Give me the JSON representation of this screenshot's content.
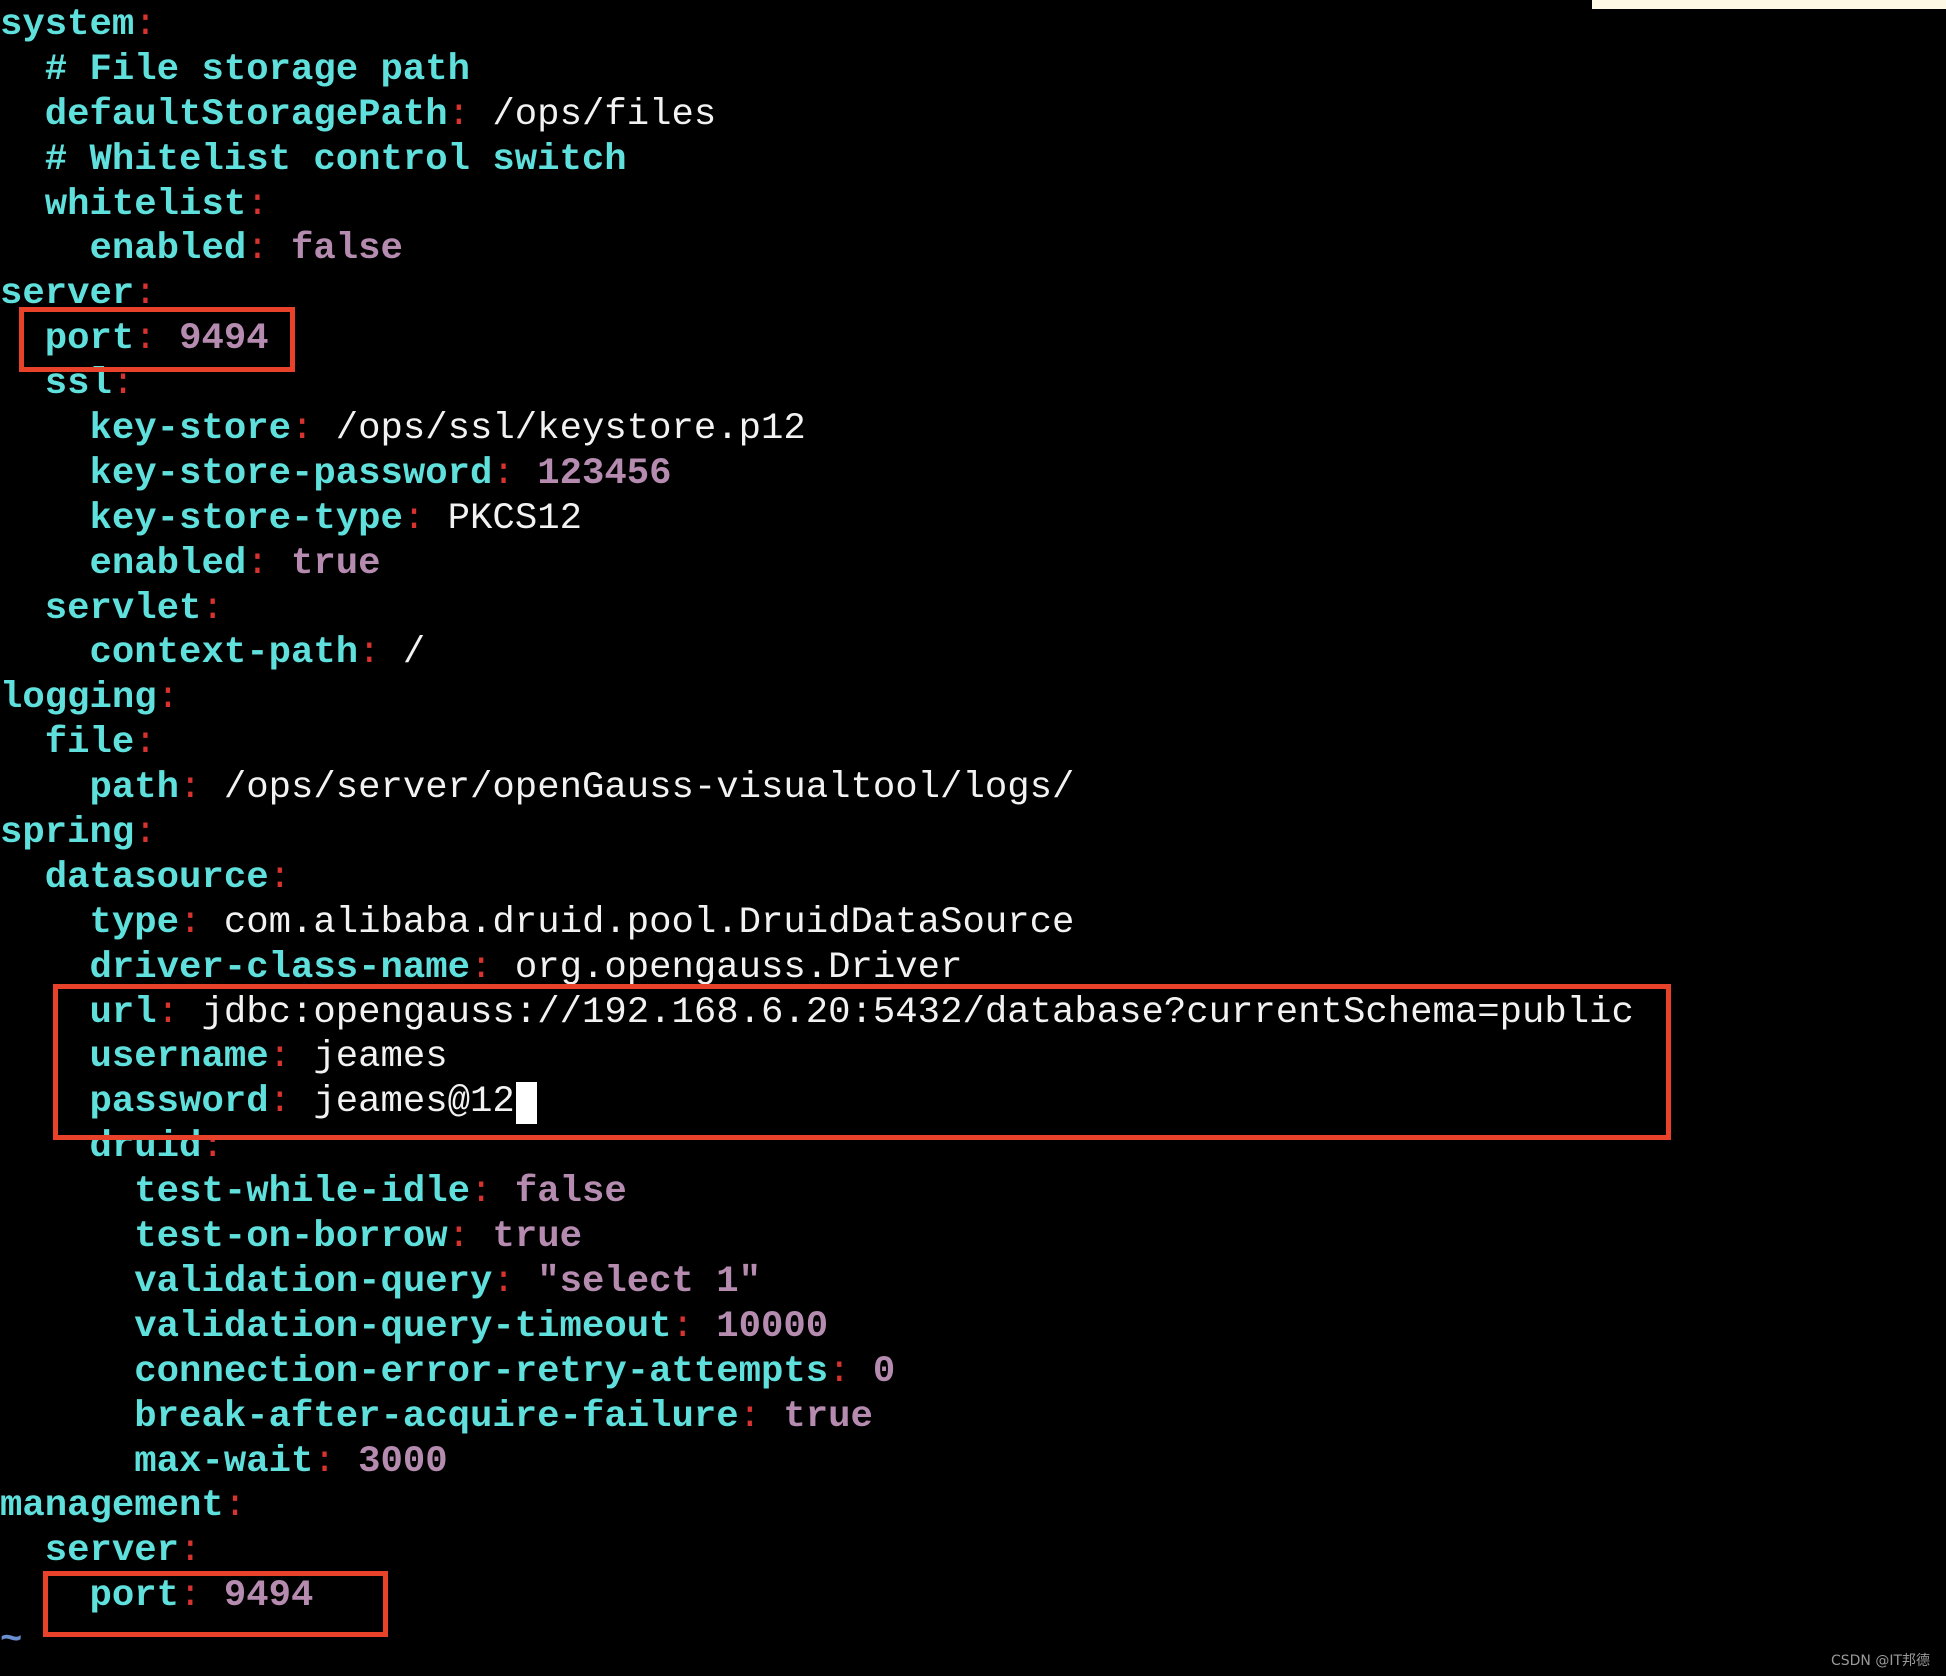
{
  "colors": {
    "key": "#5fe0dc",
    "colon": "#d8332e",
    "string": "#f2f2f2",
    "literal": "#b58bb0",
    "highlight_box": "#e8432a",
    "tilde": "#6a8fd0"
  },
  "lines": [
    {
      "indent": 0,
      "key": "system"
    },
    {
      "indent": 2,
      "comment": "# File storage path"
    },
    {
      "indent": 2,
      "key": "defaultStoragePath",
      "value": "/ops/files",
      "type": "string"
    },
    {
      "indent": 2,
      "comment": "# Whitelist control switch"
    },
    {
      "indent": 2,
      "key": "whitelist"
    },
    {
      "indent": 4,
      "key": "enabled",
      "value": "false",
      "type": "literal"
    },
    {
      "indent": 0,
      "key": "server"
    },
    {
      "indent": 2,
      "key": "port",
      "value": "9494",
      "type": "literal"
    },
    {
      "indent": 2,
      "key": "ssl"
    },
    {
      "indent": 4,
      "key": "key-store",
      "value": "/ops/ssl/keystore.p12",
      "type": "string"
    },
    {
      "indent": 4,
      "key": "key-store-password",
      "value": "123456",
      "type": "literal"
    },
    {
      "indent": 4,
      "key": "key-store-type",
      "value": "PKCS12",
      "type": "string"
    },
    {
      "indent": 4,
      "key": "enabled",
      "value": "true",
      "type": "literal"
    },
    {
      "indent": 2,
      "key": "servlet"
    },
    {
      "indent": 4,
      "key": "context-path",
      "value": "/",
      "type": "string"
    },
    {
      "indent": 0,
      "key": "logging"
    },
    {
      "indent": 2,
      "key": "file"
    },
    {
      "indent": 4,
      "key": "path",
      "value": "/ops/server/openGauss-visualtool/logs/",
      "type": "string"
    },
    {
      "indent": 0,
      "key": "spring"
    },
    {
      "indent": 2,
      "key": "datasource"
    },
    {
      "indent": 4,
      "key": "type",
      "value": "com.alibaba.druid.pool.DruidDataSource",
      "type": "string"
    },
    {
      "indent": 4,
      "key": "driver-class-name",
      "value": "org.opengauss.Driver",
      "type": "string"
    },
    {
      "indent": 4,
      "key": "url",
      "value": "jdbc:opengauss://192.168.6.20:5432/database?currentSchema=public",
      "type": "string"
    },
    {
      "indent": 4,
      "key": "username",
      "value": "jeames",
      "type": "string"
    },
    {
      "indent": 4,
      "key": "password",
      "value": "jeames@12",
      "type": "string"
    },
    {
      "indent": 4,
      "key": "druid"
    },
    {
      "indent": 6,
      "key": "test-while-idle",
      "value": "false",
      "type": "literal"
    },
    {
      "indent": 6,
      "key": "test-on-borrow",
      "value": "true",
      "type": "literal"
    },
    {
      "indent": 6,
      "key": "validation-query",
      "value": "\"select 1\"",
      "type": "literal"
    },
    {
      "indent": 6,
      "key": "validation-query-timeout",
      "value": "10000",
      "type": "literal"
    },
    {
      "indent": 6,
      "key": "connection-error-retry-attempts",
      "value": "0",
      "type": "literal"
    },
    {
      "indent": 6,
      "key": "break-after-acquire-failure",
      "value": "true",
      "type": "literal"
    },
    {
      "indent": 6,
      "key": "max-wait",
      "value": "3000",
      "type": "literal"
    },
    {
      "indent": 0,
      "key": "management"
    },
    {
      "indent": 2,
      "key": "server"
    },
    {
      "indent": 4,
      "key": "port",
      "value": "9494",
      "type": "literal"
    },
    {
      "indent": 0,
      "tilde": "~"
    }
  ],
  "watermark": "CSDN @IT邦德"
}
